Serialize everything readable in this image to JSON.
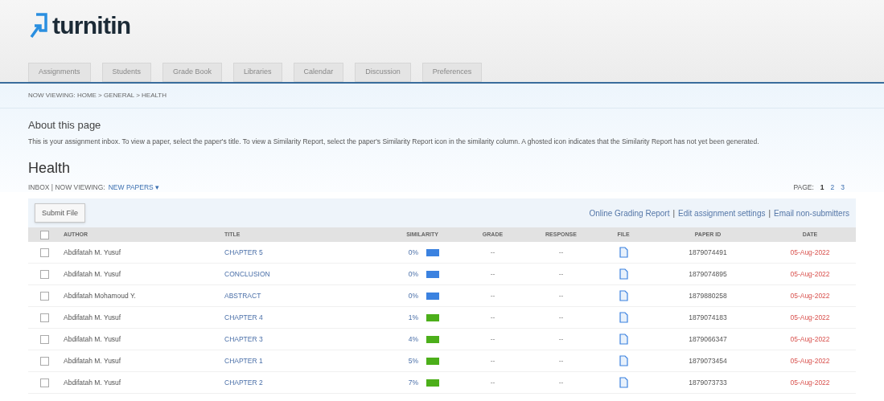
{
  "logo": {
    "text": "turnitin"
  },
  "tabs": [
    {
      "label": "Assignments"
    },
    {
      "label": "Students"
    },
    {
      "label": "Grade Book"
    },
    {
      "label": "Libraries"
    },
    {
      "label": "Calendar"
    },
    {
      "label": "Discussion"
    },
    {
      "label": "Preferences"
    }
  ],
  "breadcrumb": "NOW VIEWING: HOME > GENERAL > HEALTH",
  "about": {
    "title": "About this page",
    "text": "This is your assignment inbox. To view a paper, select the paper's title. To view a Similarity Report, select the paper's Similarity Report icon in the similarity column. A ghosted icon indicates that the Similarity Report has not yet been generated."
  },
  "heading": "Health",
  "viewing": {
    "prefix": "INBOX | NOW VIEWING:",
    "value": "NEW PAPERS ▾"
  },
  "pagination": {
    "label": "PAGE:",
    "pages": [
      {
        "label": "1",
        "selected": true
      },
      {
        "label": "2",
        "selected": false
      },
      {
        "label": "3",
        "selected": false
      }
    ]
  },
  "toolbar": {
    "submit": "Submit File",
    "links": [
      "Online Grading Report",
      "Edit assignment settings",
      "Email non-submitters"
    ],
    "separator": "|"
  },
  "table": {
    "all_checked": false,
    "columns": [
      "AUTHOR",
      "TITLE",
      "SIMILARITY",
      "GRADE",
      "RESPONSE",
      "FILE",
      "PAPER ID",
      "DATE"
    ],
    "rows": [
      {
        "checked": false,
        "author": "Abdifatah M. Yusuf",
        "title": "CHAPTER 5",
        "similarity": "0%",
        "color": "#3b82e0",
        "grade": "--",
        "response": "--",
        "paper_id": "1879074491",
        "date": "05-Aug-2022"
      },
      {
        "checked": false,
        "author": "Abdifatah M. Yusuf",
        "title": "CONCLUSION",
        "similarity": "0%",
        "color": "#3b82e0",
        "grade": "--",
        "response": "--",
        "paper_id": "1879074895",
        "date": "05-Aug-2022"
      },
      {
        "checked": false,
        "author": "Abdifatah Mohamoud Y.",
        "title": "ABSTRACT",
        "similarity": "0%",
        "color": "#3b82e0",
        "grade": "--",
        "response": "--",
        "paper_id": "1879880258",
        "date": "05-Aug-2022"
      },
      {
        "checked": false,
        "author": "Abdifatah M. Yusuf",
        "title": "CHAPTER 4",
        "similarity": "1%",
        "color": "#4caf1a",
        "grade": "--",
        "response": "--",
        "paper_id": "1879074183",
        "date": "05-Aug-2022"
      },
      {
        "checked": false,
        "author": "Abdifatah M. Yusuf",
        "title": "CHAPTER 3",
        "similarity": "4%",
        "color": "#4caf1a",
        "grade": "--",
        "response": "--",
        "paper_id": "1879066347",
        "date": "05-Aug-2022"
      },
      {
        "checked": false,
        "author": "Abdifatah M. Yusuf",
        "title": "CHAPTER 1",
        "similarity": "5%",
        "color": "#4caf1a",
        "grade": "--",
        "response": "--",
        "paper_id": "1879073454",
        "date": "05-Aug-2022"
      },
      {
        "checked": false,
        "author": "Abdifatah M. Yusuf",
        "title": "CHAPTER 2",
        "similarity": "7%",
        "color": "#4caf1a",
        "grade": "--",
        "response": "--",
        "paper_id": "1879073733",
        "date": "05-Aug-2022"
      }
    ]
  }
}
